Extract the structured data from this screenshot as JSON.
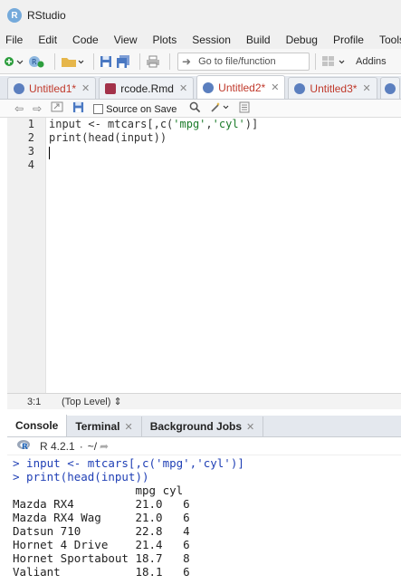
{
  "window": {
    "title": "RStudio"
  },
  "menu": [
    "File",
    "Edit",
    "Code",
    "View",
    "Plots",
    "Session",
    "Build",
    "Debug",
    "Profile",
    "Tools"
  ],
  "toolbar": {
    "goto_placeholder": "Go to file/function",
    "addins_label": "Addins"
  },
  "editor_tabs": [
    {
      "name": "Untitled1*",
      "active": false
    },
    {
      "name": "rcode.Rmd",
      "active": false
    },
    {
      "name": "Untitled2*",
      "active": true
    },
    {
      "name": "Untitled3*",
      "active": false
    }
  ],
  "editor_toolbar": {
    "source_on_save_label": "Source on Save"
  },
  "code": {
    "lines": [
      "input <- mtcars[,c('mpg','cyl')]",
      "print(head(input))",
      "",
      ""
    ],
    "line_numbers": [
      "1",
      "2",
      "3",
      "4"
    ]
  },
  "status": {
    "cursor_position": "3:1",
    "scope": "(Top Level)"
  },
  "console_tabs": [
    {
      "name": "Console",
      "active": true,
      "closable": false
    },
    {
      "name": "Terminal",
      "active": false,
      "closable": true
    },
    {
      "name": "Background Jobs",
      "active": false,
      "closable": true
    }
  ],
  "console_header": {
    "r_version": "R 4.2.1",
    "working_dir": "~/"
  },
  "console_lines": [
    {
      "type": "input",
      "text": "> input <- mtcars[,c('mpg','cyl')]"
    },
    {
      "type": "input",
      "text": "> print(head(input))"
    },
    {
      "type": "output",
      "text": "                  mpg cyl"
    },
    {
      "type": "output",
      "text": "Mazda RX4         21.0   6"
    },
    {
      "type": "output",
      "text": "Mazda RX4 Wag     21.0   6"
    },
    {
      "type": "output",
      "text": "Datsun 710        22.8   4"
    },
    {
      "type": "output",
      "text": "Hornet 4 Drive    21.4   6"
    },
    {
      "type": "output",
      "text": "Hornet Sportabout 18.7   8"
    },
    {
      "type": "output",
      "text": "Valiant           18.1   6"
    }
  ]
}
